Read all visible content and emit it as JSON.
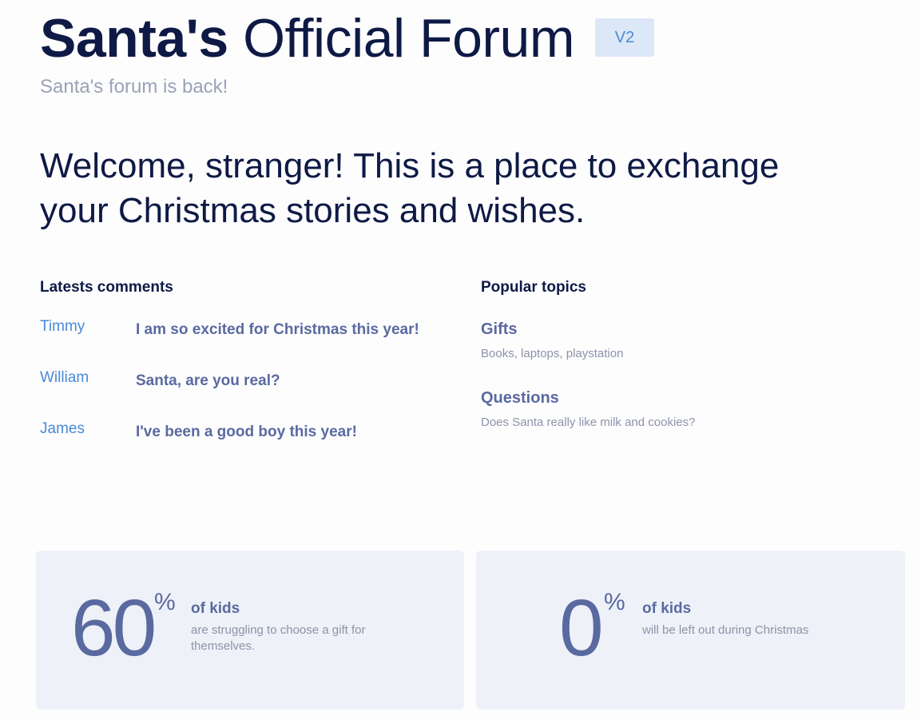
{
  "header": {
    "title_bold": "Santa's",
    "title_rest": "Official Forum",
    "badge": "V2",
    "tagline": "Santa's forum is back!"
  },
  "welcome": "Welcome, stranger! This is a place to exchange your Christmas stories and wishes.",
  "comments": {
    "heading": "Latests comments",
    "items": [
      {
        "author": "Timmy",
        "text": "I am so excited for Christmas this year!"
      },
      {
        "author": "William",
        "text": "Santa, are you real?"
      },
      {
        "author": "James",
        "text": "I've been a good boy this year!"
      }
    ]
  },
  "topics": {
    "heading": "Popular topics",
    "items": [
      {
        "title": "Gifts",
        "desc": "Books, laptops, playstation"
      },
      {
        "title": "Questions",
        "desc": "Does Santa really like milk and cookies?"
      }
    ]
  },
  "stats": [
    {
      "value": "60",
      "unit": "%",
      "label": "of kids",
      "desc": "are struggling to choose a gift for themselves."
    },
    {
      "value": "0",
      "unit": "%",
      "label": "of kids",
      "desc": "will be left out during Christmas"
    }
  ],
  "colors": {
    "primary_text": "#0e1a45",
    "accent_blue": "#4a8ad6",
    "muted_blue": "#5a6aa0",
    "badge_bg": "#dce7f7",
    "card_bg": "#eef1f8"
  }
}
